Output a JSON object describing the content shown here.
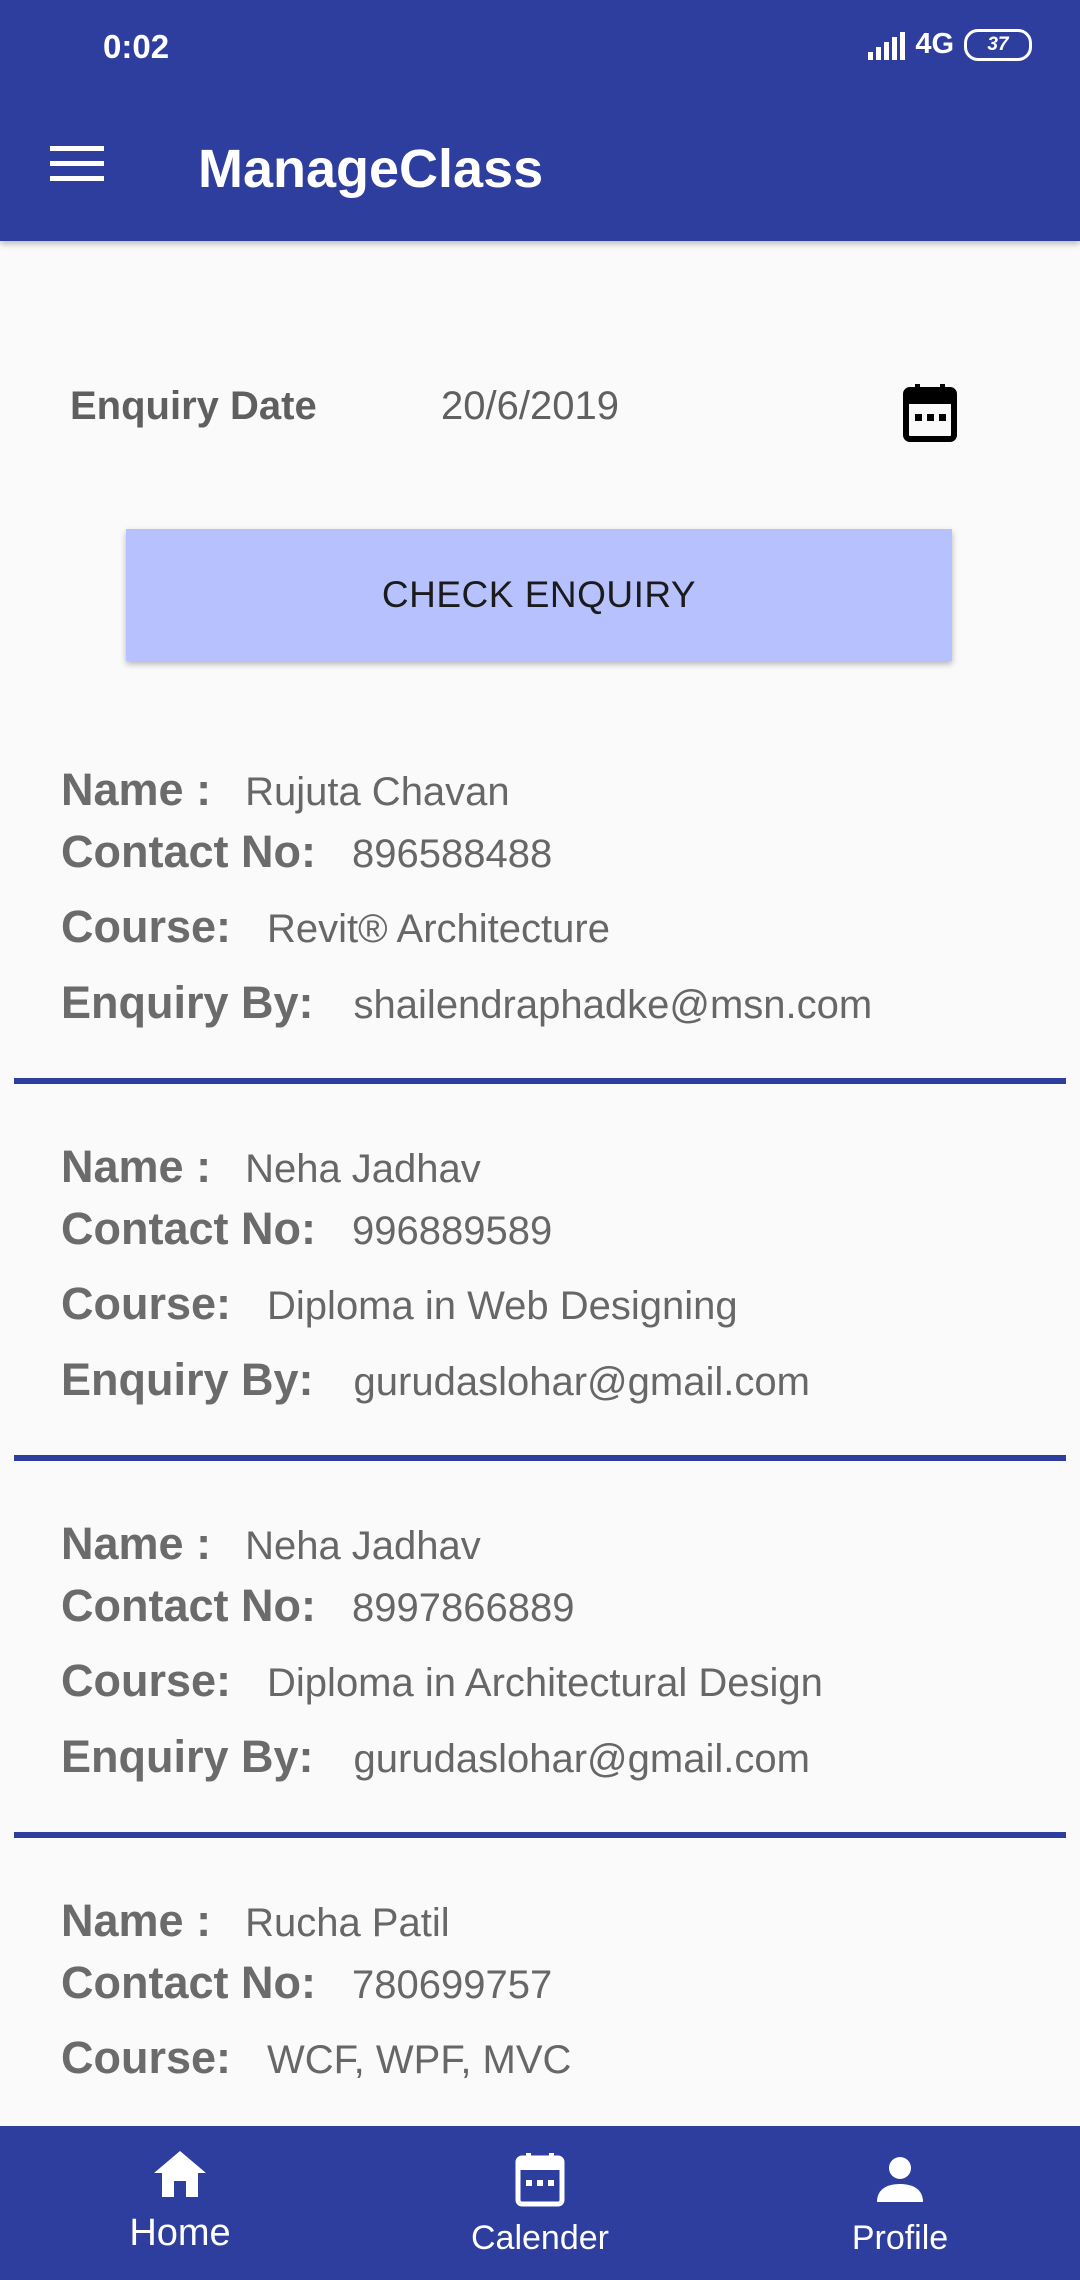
{
  "status_bar": {
    "time": "0:02",
    "network": "4G",
    "battery": "37"
  },
  "app_bar": {
    "title": "ManageClass"
  },
  "filter": {
    "date_label": "Enquiry Date",
    "date_value": "20/6/2019",
    "check_button": "CHECK ENQUIRY"
  },
  "labels": {
    "name": "Name :",
    "contact": "Contact No:",
    "course": "Course:",
    "enquiry_by": "Enquiry By:"
  },
  "enquiries": [
    {
      "name": "Rujuta Chavan",
      "contact": "896588488",
      "course": "Revit® Architecture",
      "enquiry_by": "shailendraphadke@msn.com"
    },
    {
      "name": "Neha Jadhav",
      "contact": "996889589",
      "course": "Diploma in Web Designing",
      "enquiry_by": "gurudaslohar@gmail.com"
    },
    {
      "name": "Neha Jadhav",
      "contact": "8997866889",
      "course": "Diploma in Architectural Design",
      "enquiry_by": "gurudaslohar@gmail.com"
    },
    {
      "name": "Rucha Patil",
      "contact": "780699757",
      "course": "WCF, WPF, MVC",
      "enquiry_by": ""
    }
  ],
  "bottom_nav": [
    {
      "label": "Home",
      "icon": "home-icon"
    },
    {
      "label": "Calender",
      "icon": "calendar-icon"
    },
    {
      "label": "Profile",
      "icon": "person-icon"
    }
  ],
  "colors": {
    "primary": "#2e3e9f",
    "button": "#b6c1fd",
    "background": "#fafafa"
  }
}
